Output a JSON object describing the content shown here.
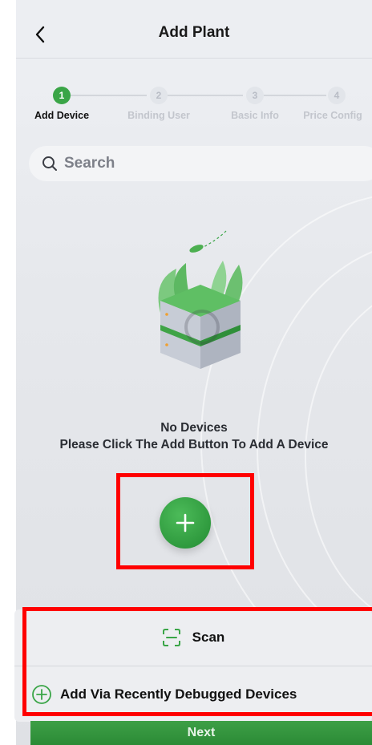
{
  "header": {
    "title": "Add Plant",
    "back_icon": "chevron-left-icon"
  },
  "stepper": {
    "steps": [
      {
        "number": "1",
        "label": "Add Device",
        "active": true
      },
      {
        "number": "2",
        "label": "Binding User",
        "active": false
      },
      {
        "number": "3",
        "label": "Basic Info",
        "active": false
      },
      {
        "number": "4",
        "label": "Price Config",
        "active": false
      }
    ]
  },
  "search": {
    "placeholder": "Search",
    "icon": "search-icon"
  },
  "empty_state": {
    "title": "No Devices",
    "subtitle": "Please Click The Add Button To Add A Device"
  },
  "add_button": {
    "icon": "plus-icon"
  },
  "action_sheet": {
    "scan_label": "Scan",
    "scan_icon": "scan-icon",
    "recent_label": "Add Via Recently Debugged Devices",
    "recent_icon": "plus-circle-icon"
  },
  "footer": {
    "next_label": "Next"
  },
  "colors": {
    "accent": "#3aa547",
    "highlight": "#ff0000"
  }
}
